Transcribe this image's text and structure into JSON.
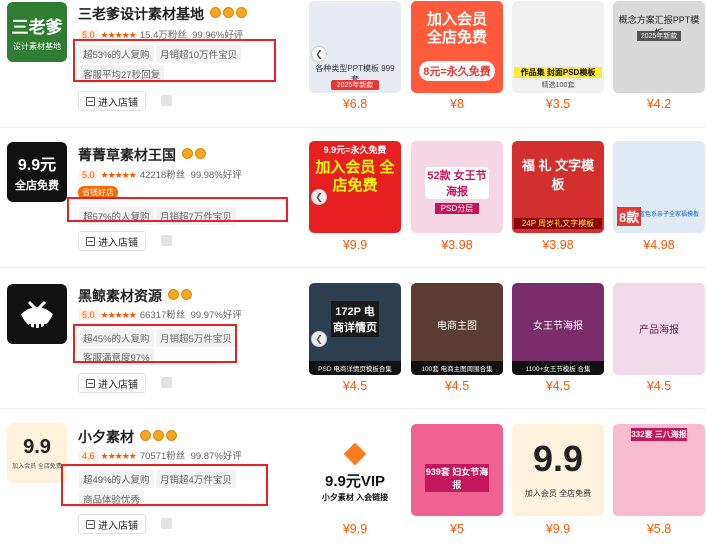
{
  "common": {
    "enter_label": "进入店铺",
    "stars": "★★★★★"
  },
  "shops": [
    {
      "logo_text": "三老爹",
      "logo_sub": "设计素材基地",
      "name": "三老爹设计素材基地",
      "score": "5.0",
      "fans": "15.4万粉丝",
      "rating": "99.96%好评",
      "tags": [
        "超53%的人复购",
        "月销超10万件宝贝",
        "客服平均27秒回复"
      ],
      "promo": "",
      "thumbs": [
        {
          "text": "各种类型PPT模板 999套",
          "badge": "2025年新款",
          "bg": "#e8ecf2",
          "fg": "#334"
        },
        {
          "text": "加入会员 全店免费",
          "badge": "8元=永久免费",
          "bg": "#ff5a3c",
          "fg": "#ffffff"
        },
        {
          "text": "作品集 封面PSD模板",
          "badge": "精选100套",
          "bg": "#f1f1f1",
          "fg": "#111"
        },
        {
          "text": "概念方案汇报PPT模板",
          "badge": "2025年新款",
          "bg": "#d9d9d9",
          "fg": "#222"
        }
      ],
      "prices": [
        "¥6.8",
        "¥8",
        "¥3.5",
        "¥4.2"
      ]
    },
    {
      "logo_text": "9.9元",
      "logo_sub": "全店免费",
      "name": "菁菁草素材王国",
      "score": "5.0",
      "fans": "42218粉丝",
      "rating": "99.98%好评",
      "tags": [
        "超57%的人复购",
        "月销超7万件宝贝"
      ],
      "promo": "省钱好店",
      "thumbs": [
        {
          "text": "加入会员 全店免费",
          "badge": "9.9元=永久免费",
          "bg": "#e62020",
          "fg": "#ffff00"
        },
        {
          "text": "52款 女王节海报",
          "badge": "PSD分层",
          "bg": "#f7d6e4",
          "fg": "#c2185b"
        },
        {
          "text": "福 礼 文字模板",
          "badge": "24P 周岁礼文字模板",
          "bg": "#d32f2f",
          "fg": "#ffffff"
        },
        {
          "text": "蓝色系亲子全家福模板",
          "badge": "8款",
          "bg": "#dfeaf5",
          "fg": "#e53935"
        }
      ],
      "prices": [
        "¥9.9",
        "¥3.98",
        "¥3.98",
        "¥4.98"
      ]
    },
    {
      "logo_text": "",
      "logo_sub": "",
      "name": "黑鲸素材资源",
      "score": "5.0",
      "fans": "66317粉丝",
      "rating": "99.97%好评",
      "tags": [
        "超45%的人复购",
        "月销超5万件宝贝",
        "客服满意度97%"
      ],
      "promo": "",
      "thumbs": [
        {
          "text": "172P 电商详情页",
          "badge": "PSD 电商详情页模板合集",
          "bg": "#2c3e50",
          "fg": "#ffffff"
        },
        {
          "text": "电商主图",
          "badge": "100套 电商主图周围合集",
          "bg": "#5a3d30",
          "fg": "#ffffff"
        },
        {
          "text": "女王节海报",
          "badge": "1100+女王节模板 合集",
          "bg": "#7b2d6b",
          "fg": "#ffffff"
        },
        {
          "text": "产品海报",
          "badge": "",
          "bg": "#f2dbe8",
          "fg": "#6a1b4d"
        }
      ],
      "prices": [
        "¥4.5",
        "¥4.5",
        "¥4.5",
        "¥4.5"
      ]
    },
    {
      "logo_text": "9.9",
      "logo_sub": "加入会员 全店免费",
      "name": "小夕素材",
      "score": "4.6",
      "fans": "70571粉丝",
      "rating": "99.87%好评",
      "tags": [
        "超49%的人复购",
        "月销超4万件宝贝",
        "商品体验优秀"
      ],
      "promo": "",
      "thumbs": [
        {
          "text": "9.9元VIP",
          "badge": "小夕素材 入会链接",
          "bg": "#ffffff",
          "fg": "#111"
        },
        {
          "text": "939套 妇女节海报",
          "badge": "",
          "bg": "#f06292",
          "fg": "#ffffff"
        },
        {
          "text": "9.9",
          "badge": "加入会员 全店免费",
          "bg": "#fdf3dc",
          "fg": "#222"
        },
        {
          "text": "332套 三八海报",
          "badge": "",
          "bg": "#f8bbd0",
          "fg": "#c2185b"
        }
      ],
      "prices": [
        "¥9.9",
        "¥5",
        "¥9.9",
        "¥5.8"
      ]
    }
  ]
}
